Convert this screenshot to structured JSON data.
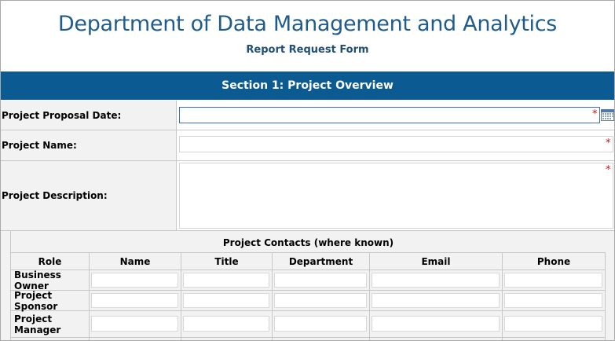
{
  "header": {
    "department_title": "Department of Data Management and Analytics",
    "form_title": "Report Request Form"
  },
  "section1": {
    "title": "Section 1: Project Overview",
    "fields": {
      "proposal_date": {
        "label": "Project Proposal Date:",
        "value": "",
        "required_marker": "*"
      },
      "project_name": {
        "label": "Project Name:",
        "value": "",
        "required_marker": "*"
      },
      "project_description": {
        "label": "Project Description:",
        "value": "",
        "required_marker": "*"
      }
    }
  },
  "contacts": {
    "title": "Project Contacts (where known)",
    "columns": [
      "Role",
      "Name",
      "Title",
      "Department",
      "Email",
      "Phone"
    ],
    "rows": [
      {
        "role": "Business Owner"
      },
      {
        "role": "Project Sponsor"
      },
      {
        "role": "Project Manager"
      }
    ]
  },
  "colors": {
    "title_blue": "#1f5c8b",
    "section_bar": "#0b5a91",
    "required_red": "#d01010",
    "label_bg": "#f2f2f2"
  },
  "icons": {
    "date_picker": "calendar-icon"
  }
}
